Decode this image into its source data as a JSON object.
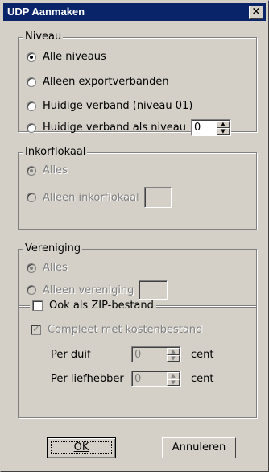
{
  "window": {
    "title": "UDP Aanmaken",
    "close_label": "×"
  },
  "niveau": {
    "legend": "Niveau",
    "options": [
      {
        "label": "Alle niveaus",
        "selected": true
      },
      {
        "label": "Alleen exportverbanden",
        "selected": false
      },
      {
        "label": "Huidige verband (niveau 01)",
        "selected": false
      },
      {
        "label": "Huidige verband als niveau",
        "selected": false
      }
    ],
    "level_value": "0"
  },
  "inkorflokaal": {
    "legend": "Inkorflokaal",
    "options": [
      {
        "label": "Alles",
        "selected": true
      },
      {
        "label": "Alleen inkorflokaal",
        "selected": false
      }
    ],
    "value": ""
  },
  "vereniging": {
    "legend": "Vereniging",
    "options": [
      {
        "label": "Alles",
        "selected": true
      },
      {
        "label": "Alleen vereniging",
        "selected": false
      }
    ],
    "value": ""
  },
  "zip": {
    "label": "Ook als ZIP-bestand",
    "checked": false,
    "compleet_label": "Compleet met kostenbestand",
    "compleet_checked": true,
    "per_duif_label": "Per duif",
    "per_duif_value": "0",
    "per_liefhebber_label": "Per liefhebber",
    "per_liefhebber_value": "0",
    "unit": "cent"
  },
  "buttons": {
    "ok_label": "OK",
    "cancel_label": "Annuleren"
  }
}
